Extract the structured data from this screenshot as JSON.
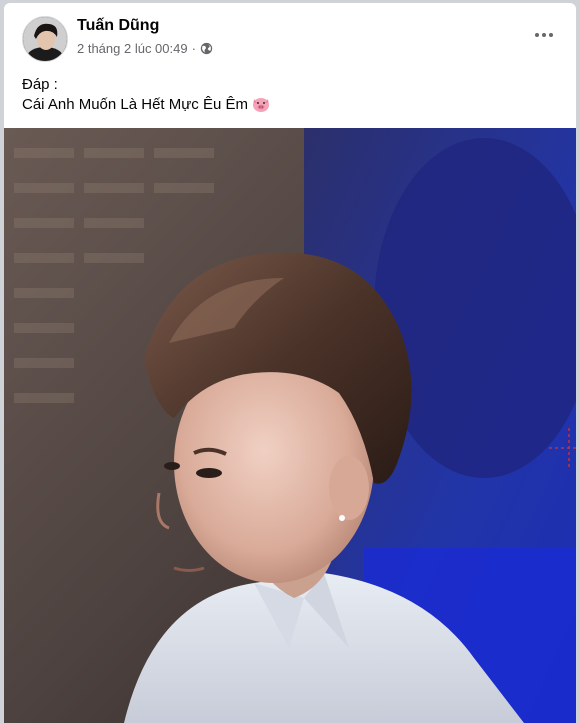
{
  "post": {
    "author_name": "Tuấn Dũng",
    "timestamp": "2 tháng 2 lúc 00:49",
    "separator": "·",
    "privacy_icon": "globe-icon",
    "more_icon": "more-options-icon",
    "text_line_1": "Đáp :",
    "text_line_2": "Cái Anh Muốn Là Hết Mực Êu Êm",
    "emoji_icon": "pig-face-icon",
    "photo_subject": "young man with swept hairstyle in white shirt, looking left"
  },
  "colors": {
    "background": "#cfd3d8",
    "card": "#ffffff",
    "name_text": "#050505",
    "meta_text": "#65676b"
  }
}
